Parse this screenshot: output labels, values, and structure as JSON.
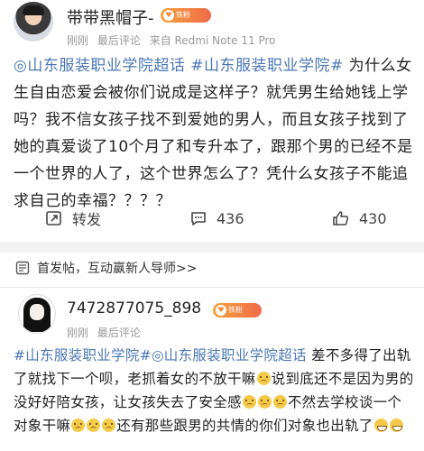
{
  "post": {
    "username": "带带黑帽子-",
    "badge": "铁粉",
    "time": "刚刚",
    "meta_label": "最后评论",
    "source": "来自 Redmi Note 11 Pro",
    "topic1": "◎山东服装职业学院超话",
    "topic2": "#山东服装职业学院#",
    "body": " 为什么女生自由恋爱会被你们说成是这样子？就凭男生给她钱上学吗？我不信女孩子找不到爱她的男人，而且女孩子找到了她的真爱谈了10个月了和专升本了，跟那个男的已经不是一个世界的人了，这个世界怎么了？凭什么女孩子不能追求自己的幸福？？？？",
    "actions": {
      "repost_label": "转发",
      "comment_count": "436",
      "like_count": "430"
    }
  },
  "hint": {
    "text": "首发帖，互动赢新人导师>>"
  },
  "comment": {
    "username": "7472877075_898",
    "badge": "铁粉",
    "time": "刚刚",
    "meta_label": "最后评论",
    "topic1": "#山东服装职业学院#",
    "topic2": "◎山东服装职业学院超话",
    "text1": " 差不多得了出轨了就找下一个呗，老抓着女的不放干嘛",
    "text2": "说到底还不是因为男的没好好陪女孩，让女孩失去了安全感",
    "text3": "不然去学校谈一个对象干嘛",
    "text4": "还有那些跟男的共情的你们对象也出轨了"
  },
  "icons": {
    "repost": "repost-icon",
    "comment": "comment-icon",
    "like": "thumbs-up-icon",
    "hint": "post-icon"
  },
  "colors": {
    "topic": "#4a78b4",
    "badge_start": "#f7a23b",
    "badge_end": "#ef6b4a",
    "meta": "#999999"
  }
}
